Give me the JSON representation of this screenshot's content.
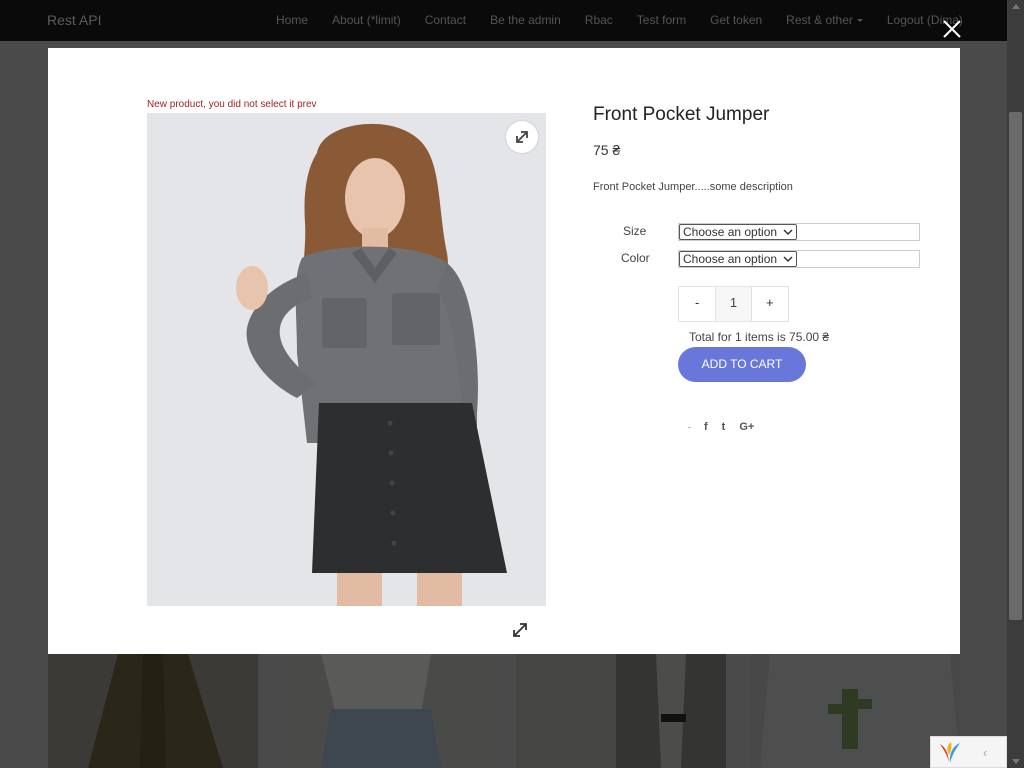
{
  "navbar": {
    "brand": "Rest API",
    "items": [
      {
        "label": "Home"
      },
      {
        "label": "About (*limit)"
      },
      {
        "label": "Contact"
      },
      {
        "label": "Be the admin"
      },
      {
        "label": "Rbac"
      },
      {
        "label": "Test form"
      },
      {
        "label": "Get token"
      },
      {
        "label": "Rest & other"
      },
      {
        "label": "Logout (Dima)"
      }
    ]
  },
  "modal": {
    "notice": "New product, you did not select it prev",
    "product": {
      "title": "Front Pocket Jumper",
      "price": "75 ₴",
      "description": "Front Pocket Jumper.....some description"
    },
    "variations": {
      "size_label": "Size",
      "size_value": "Choose an option",
      "color_label": "Color",
      "color_value": "Choose an option"
    },
    "quantity": {
      "minus": "-",
      "value": "1",
      "plus": "+"
    },
    "total": "Total for 1 items is 75.00 ₴",
    "add_to_cart": "ADD TO CART",
    "social": {
      "facebook": "f",
      "twitter": "t",
      "google": "G+"
    }
  },
  "colors": {
    "accent": "#6a77da",
    "notice": "#a02424",
    "navbar": "#0a0a0a",
    "backdrop": "#4a4a4a"
  }
}
